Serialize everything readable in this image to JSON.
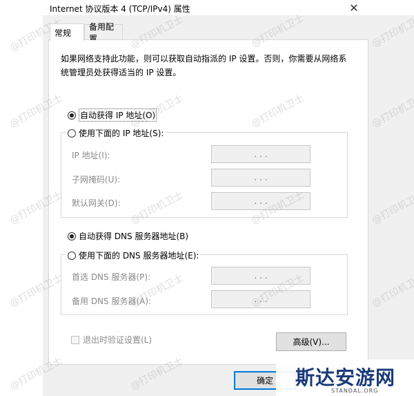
{
  "window": {
    "title": "Internet 协议版本 4 (TCP/IPv4) 属性",
    "close_glyph": "✕"
  },
  "tabs": [
    {
      "label": "常规",
      "active": true
    },
    {
      "label": "备用配置",
      "active": false
    }
  ],
  "description": "如果网络支持此功能，则可以获取自动指派的 IP 设置。否则，你需要从网络系统管理员处获得适当的 IP 设置。",
  "ip_section": {
    "auto_option": {
      "label": "自动获得 IP 地址(O)",
      "selected": true
    },
    "manual_option": {
      "label": "使用下面的 IP 地址(S):",
      "selected": false
    },
    "fields": [
      {
        "label": "IP 地址(I):",
        "value": ". . ."
      },
      {
        "label": "子网掩码(U):",
        "value": ". . ."
      },
      {
        "label": "默认网关(D):",
        "value": ". . ."
      }
    ]
  },
  "dns_section": {
    "auto_option": {
      "label": "自动获得 DNS 服务器地址(B)",
      "selected": true
    },
    "manual_option": {
      "label": "使用下面的 DNS 服务器地址(E):",
      "selected": false
    },
    "fields": [
      {
        "label": "首选 DNS 服务器(P):",
        "value": ". . ."
      },
      {
        "label": "备用 DNS 服务器(A):",
        "value": ". . ."
      }
    ]
  },
  "validate_checkbox": {
    "label": "退出时验证设置(L)",
    "checked": false
  },
  "buttons": {
    "advanced": "高级(V)...",
    "ok": "确定"
  },
  "watermark_text": "@打印机卫士",
  "brand": {
    "name": "斯达安游网",
    "domain": "STANDAL.ORG"
  },
  "colors": {
    "dialog_bg": "#f0f0f0",
    "panel_bg": "#ffffff",
    "default_button_border": "#0078d7",
    "brand_color": "#1a3a7a"
  }
}
